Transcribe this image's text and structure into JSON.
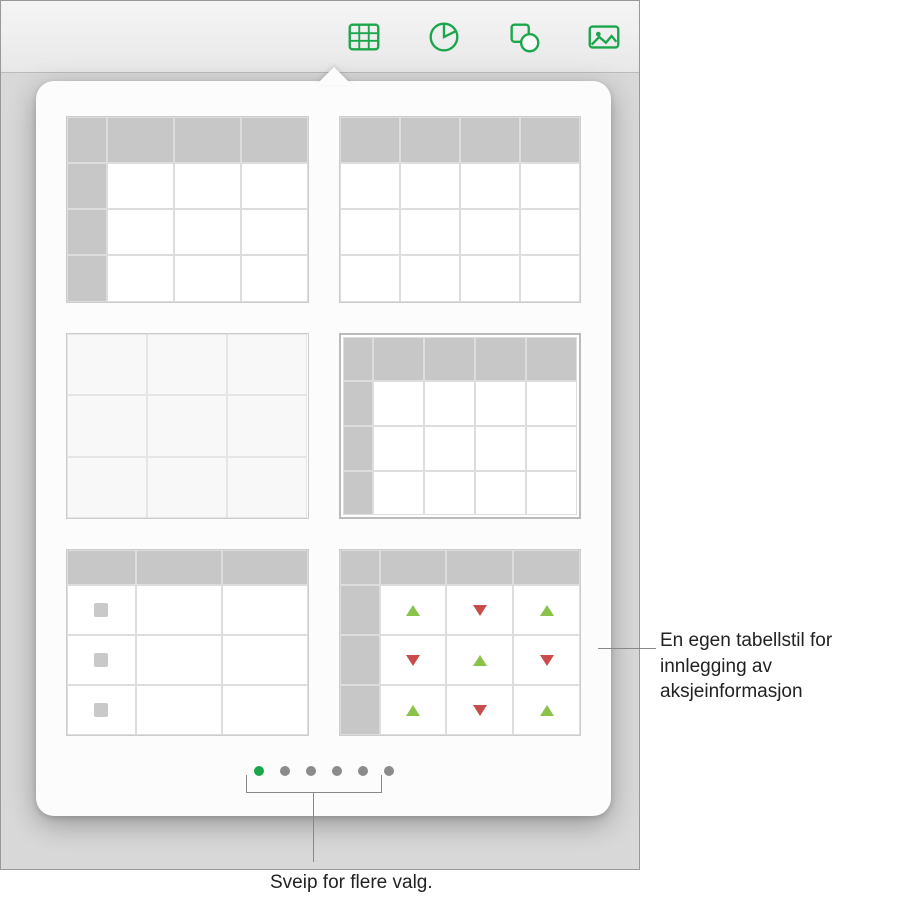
{
  "toolbar": {
    "buttons": [
      {
        "name": "table-icon",
        "active": true
      },
      {
        "name": "chart-icon",
        "active": false
      },
      {
        "name": "shape-icon",
        "active": false
      },
      {
        "name": "media-icon",
        "active": false
      }
    ]
  },
  "popover": {
    "styles": [
      {
        "name": "table-style-header-row-col"
      },
      {
        "name": "table-style-header-row"
      },
      {
        "name": "table-style-plain"
      },
      {
        "name": "table-style-boxed"
      },
      {
        "name": "table-style-checkbox"
      },
      {
        "name": "table-style-stock"
      }
    ],
    "page_count": 6,
    "active_page": 0
  },
  "callouts": {
    "stock_style": "En egen tabellstil for innlegging av aksjeinformasjon",
    "swipe_hint": "Sveip for flere valg."
  }
}
